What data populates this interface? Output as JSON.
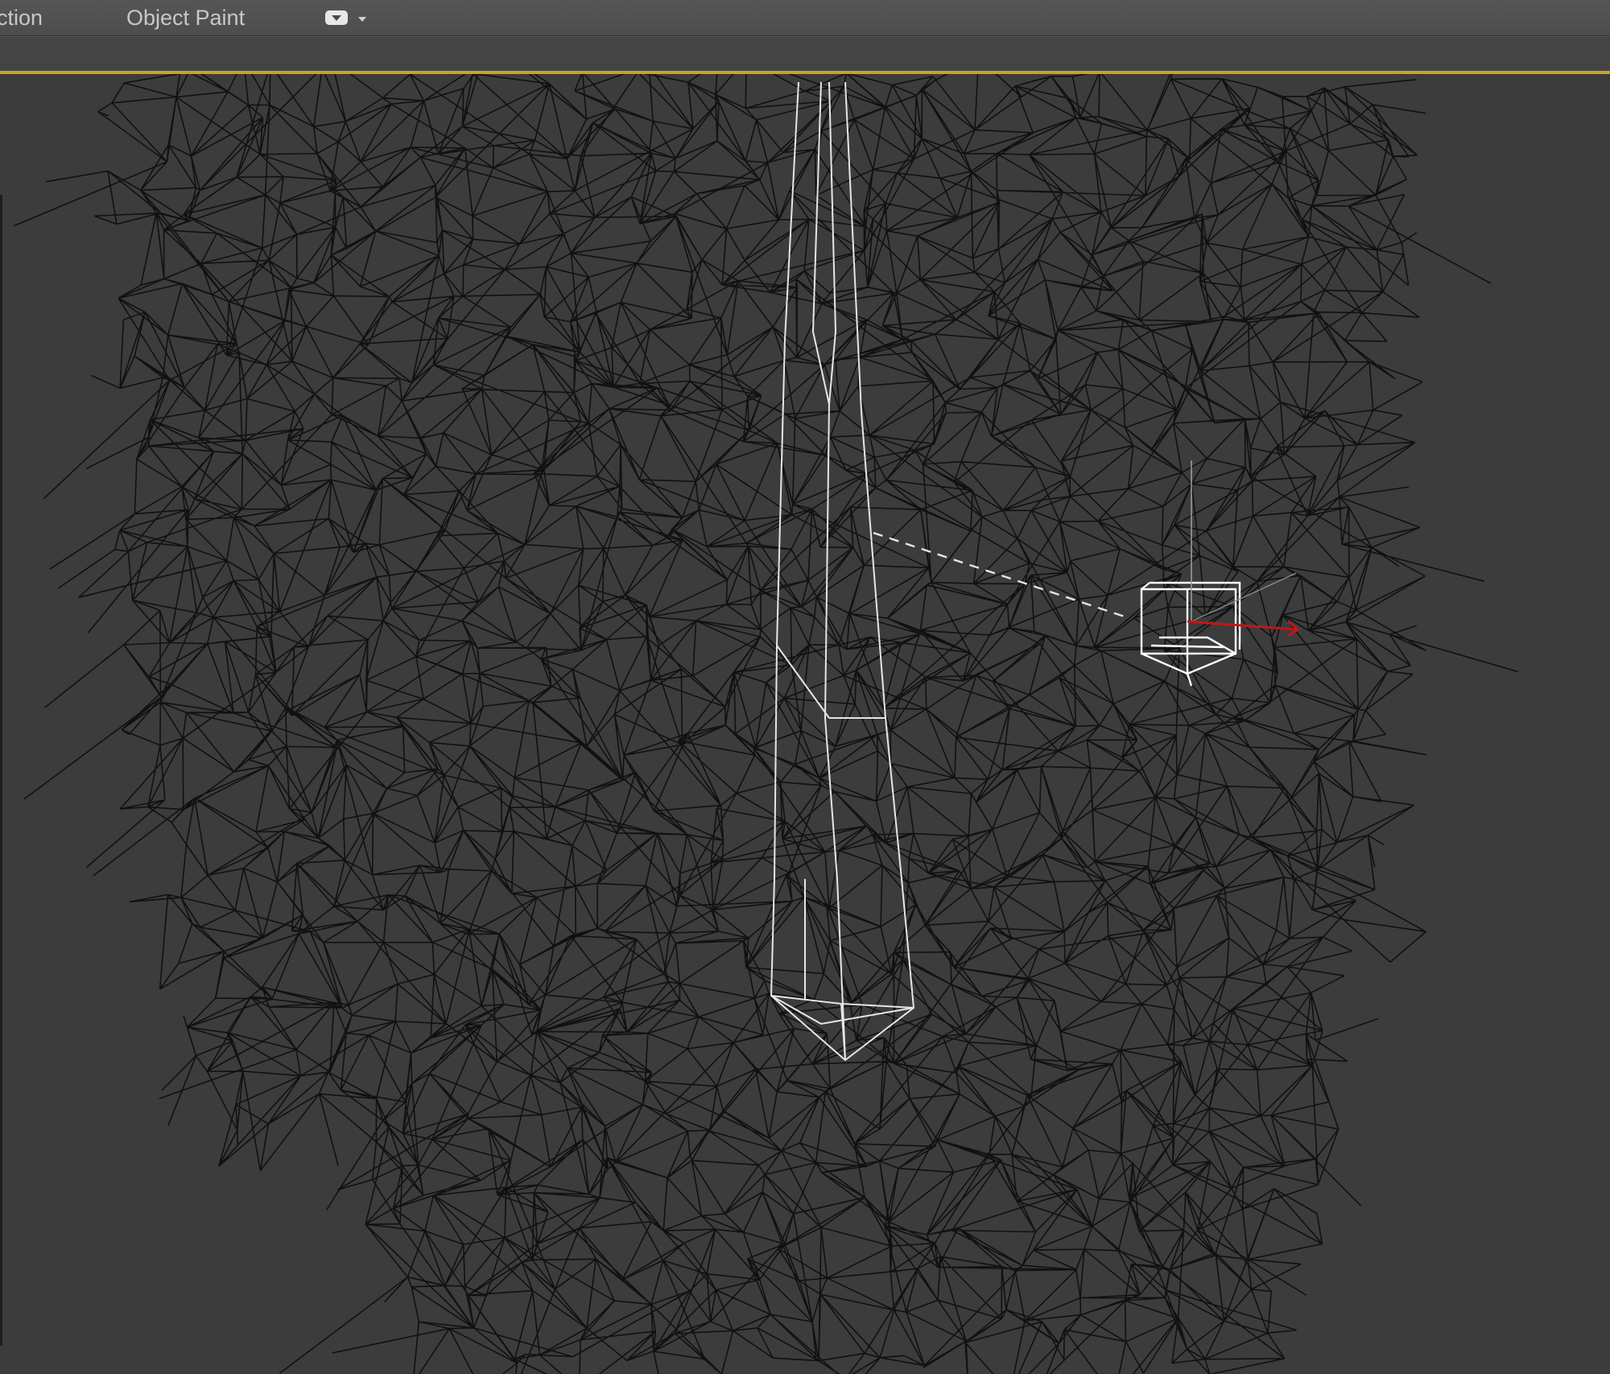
{
  "ribbon": {
    "tabs": [
      {
        "label": "ction"
      },
      {
        "label": "Object Paint"
      }
    ],
    "toggle_icon": "ribbon-minimize-icon"
  },
  "viewport": {
    "mode": "wireframe",
    "background_color": "#3c3c3c",
    "active_border_color": "#c9a227",
    "mesh_line_color": "#111111",
    "selected_line_color": "#e6e6e6",
    "gizmo_x_axis_color": "#c01818"
  }
}
